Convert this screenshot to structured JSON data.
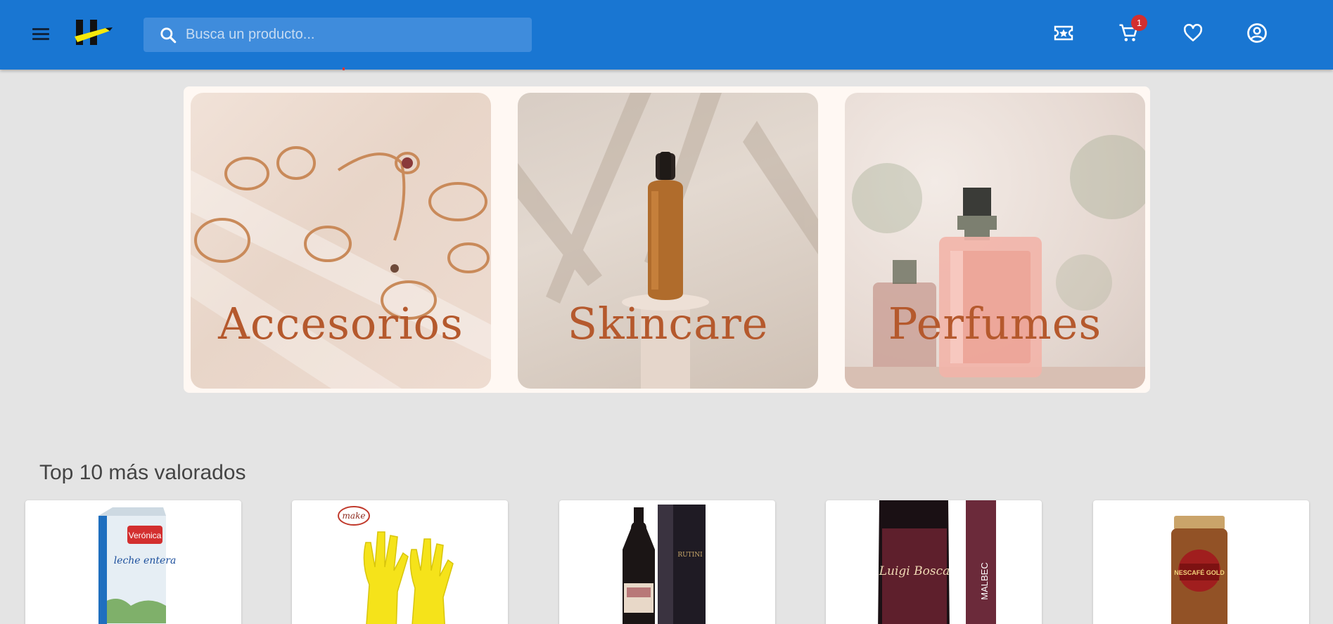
{
  "header": {
    "search_placeholder": "Busca un producto...",
    "cart_count": "1",
    "icons": [
      "menu-icon",
      "logo",
      "search-icon",
      "coupon-icon",
      "cart-icon",
      "heart-icon",
      "account-icon"
    ],
    "colors": {
      "appbar": "#1976d2",
      "badge": "#d32f2f"
    }
  },
  "banner": {
    "tiles": [
      {
        "label": "Accesorios"
      },
      {
        "label": "Skincare"
      },
      {
        "label": "Perfumes"
      }
    ],
    "colors": {
      "label": "#b5592d",
      "background": "#fff8f3"
    }
  },
  "top_rated": {
    "title": "Top 10 más valorados",
    "products": [
      {
        "image": "milk-carton",
        "brand_text": "Verónica",
        "name_text": "leche entera"
      },
      {
        "image": "yellow-gloves",
        "brand_text": "make"
      },
      {
        "image": "wine-bottle-box",
        "brand_text": "RUTINI"
      },
      {
        "image": "wine-bottle",
        "brand_text": "Luigi Bosca",
        "variety_text": "MALBEC"
      },
      {
        "image": "coffee-jar",
        "brand_text": "NESCAFÉ GOLD"
      }
    ]
  }
}
